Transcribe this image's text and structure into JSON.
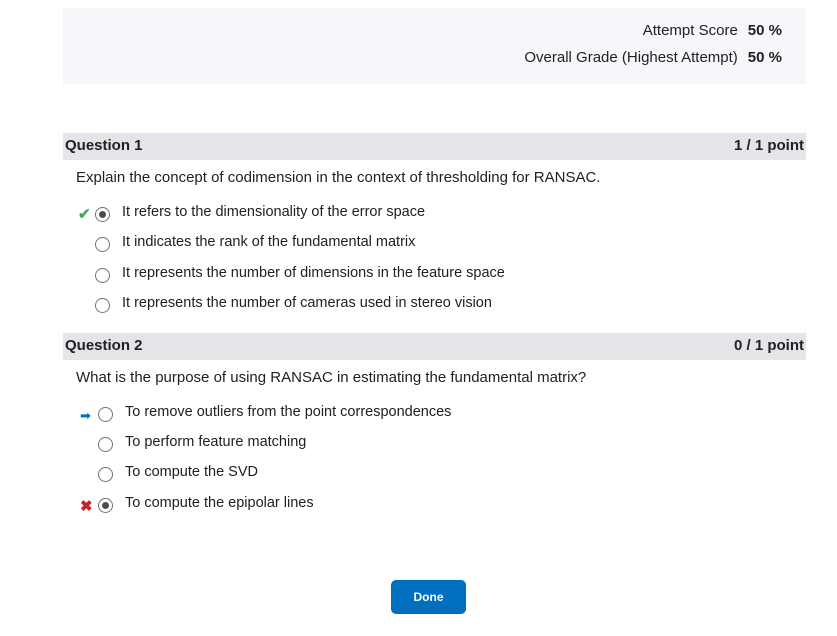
{
  "summary": {
    "attempt_score_label": "Attempt Score",
    "attempt_score_value": "50 %",
    "overall_grade_label": "Overall Grade (Highest Attempt)",
    "overall_grade_value": "50 %"
  },
  "questions": [
    {
      "title": "Question 1",
      "points": "1 / 1 point",
      "text": "Explain the concept of codimension in the context of thresholding for RANSAC.",
      "options": [
        {
          "label": "It refers to the dimensionality of the error space",
          "selected": true,
          "marker": "check-icon"
        },
        {
          "label": "It indicates the rank of the fundamental matrix",
          "selected": false,
          "marker": ""
        },
        {
          "label": "It represents the number of dimensions in the feature space",
          "selected": false,
          "marker": ""
        },
        {
          "label": "It represents the number of cameras used in stereo vision",
          "selected": false,
          "marker": ""
        }
      ]
    },
    {
      "title": "Question 2",
      "points": "0 / 1 point",
      "text": "What is the purpose of using RANSAC in estimating the fundamental matrix?",
      "options": [
        {
          "label": "To remove outliers from the point correspondences",
          "selected": false,
          "marker": "correct-answer-arrow-icon"
        },
        {
          "label": "To perform feature matching",
          "selected": false,
          "marker": ""
        },
        {
          "label": "To compute the SVD",
          "selected": false,
          "marker": ""
        },
        {
          "label": "To compute the epipolar lines",
          "selected": true,
          "marker": "incorrect-x-icon"
        }
      ]
    }
  ],
  "done_label": "Done",
  "colors": {
    "accent": "#006fbf",
    "correct": "#46a661",
    "incorrect": "#cd2026",
    "header_bg": "#e3e5e8",
    "summary_bg": "#f5f7fa"
  }
}
